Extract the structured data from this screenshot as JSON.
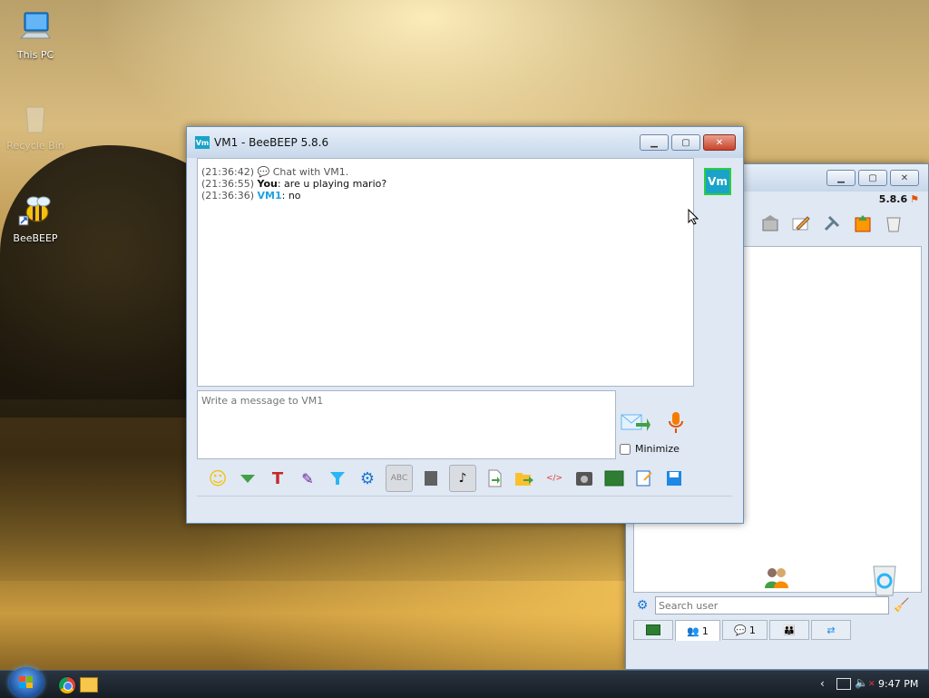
{
  "desktop": {
    "icons": [
      {
        "label": "This PC"
      },
      {
        "label": "Recycle Bin"
      },
      {
        "label": "BeeBEEP"
      }
    ]
  },
  "chat_window": {
    "title": "VM1 - BeeBEEP 5.8.6",
    "app_badge": "Vm",
    "avatar_label": "Vm",
    "messages": [
      {
        "time": "(21:36:42)",
        "sender": "",
        "text": "Chat with VM1."
      },
      {
        "time": "(21:36:55)",
        "sender": "You",
        "text": ": are u playing mario?"
      },
      {
        "time": "(21:36:36)",
        "sender": "VM1",
        "text": ": no"
      }
    ],
    "input_placeholder": "Write a message to VM1",
    "minimize_label": "Minimize"
  },
  "main_window": {
    "version": "5.8.6",
    "search_placeholder": "Search user",
    "tabs": [
      {
        "count": ""
      },
      {
        "count": "1"
      },
      {
        "count": "1"
      },
      {
        "count": ""
      },
      {
        "count": ""
      }
    ]
  },
  "taskbar": {
    "time": "9:47 PM"
  },
  "colors": {
    "accent": "#00a3d9",
    "vm_badge": "#1aa3c8",
    "sender_vm": "#1fa3e0"
  }
}
